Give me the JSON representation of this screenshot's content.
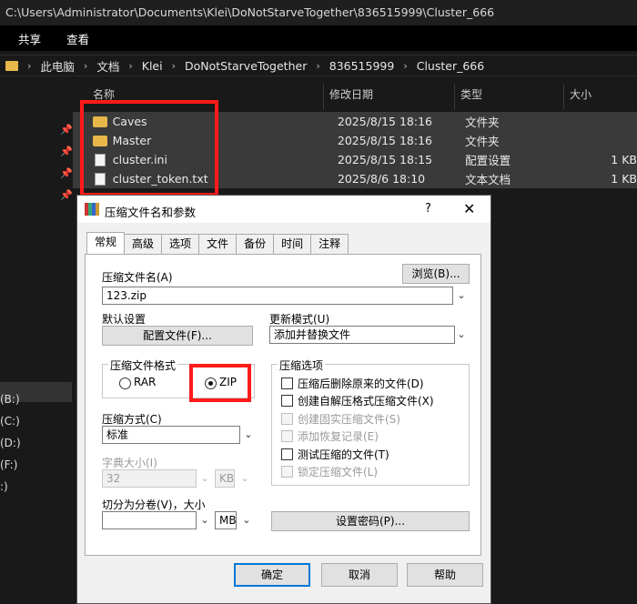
{
  "explorer": {
    "title_path": "C:\\Users\\Administrator\\Documents\\Klei\\DoNotStarveTogether\\836515999\\Cluster_666",
    "ribbon_tabs": [
      "共享",
      "查看"
    ],
    "breadcrumb": [
      "此电脑",
      "文档",
      "Klei",
      "DoNotStarveTogether",
      "836515999",
      "Cluster_666"
    ],
    "columns": {
      "name": "名称",
      "date": "修改日期",
      "type": "类型",
      "size": "大小"
    },
    "files": [
      {
        "name": "Caves",
        "date": "2025/8/15 18:16",
        "type": "文件夹",
        "size": "",
        "icon": "folder-icon"
      },
      {
        "name": "Master",
        "date": "2025/8/15 18:16",
        "type": "文件夹",
        "size": "",
        "icon": "folder-icon"
      },
      {
        "name": "cluster.ini",
        "date": "2025/8/15 18:15",
        "type": "配置设置",
        "size": "1 KB",
        "icon": "settings-file-icon"
      },
      {
        "name": "cluster_token.txt",
        "date": "2025/8/6 18:10",
        "type": "文本文档",
        "size": "1 KB",
        "icon": "text-file-icon"
      }
    ],
    "drives": [
      "(B:)",
      "(C:)",
      "(D:)",
      "(F:)",
      ":)"
    ]
  },
  "dialog": {
    "title": "压缩文件名和参数",
    "help_label": "?",
    "close_label": "✕",
    "tabs": [
      "常规",
      "高级",
      "选项",
      "文件",
      "备份",
      "时间",
      "注释"
    ],
    "archive_name_label": "压缩文件名(A)",
    "browse_label": "浏览(B)...",
    "archive_name_value": "123.zip",
    "default_settings_label": "默认设置",
    "profiles_label": "配置文件(F)...",
    "update_mode_label": "更新模式(U)",
    "update_mode_value": "添加并替换文件",
    "format_group_label": "压缩文件格式",
    "format_rar": "RAR",
    "format_zip": "ZIP",
    "format_selected": "ZIP",
    "method_label": "压缩方式(C)",
    "method_value": "标准",
    "dict_label": "字典大小(I)",
    "dict_value": "32",
    "dict_unit": "KB",
    "split_label": "切分为分卷(V)，大小",
    "split_value": "",
    "split_unit": "MB",
    "options_group_label": "压缩选项",
    "options": [
      {
        "label": "压缩后删除原来的文件(D)",
        "enabled": true,
        "checked": false
      },
      {
        "label": "创建自解压格式压缩文件(X)",
        "enabled": true,
        "checked": false
      },
      {
        "label": "创建固实压缩文件(S)",
        "enabled": false,
        "checked": false
      },
      {
        "label": "添加恢复记录(E)",
        "enabled": false,
        "checked": false
      },
      {
        "label": "测试压缩的文件(T)",
        "enabled": true,
        "checked": false
      },
      {
        "label": "锁定压缩文件(L)",
        "enabled": false,
        "checked": false
      }
    ],
    "set_password_label": "设置密码(P)...",
    "ok_label": "确定",
    "cancel_label": "取消",
    "help_button_label": "帮助"
  },
  "colors": {
    "highlight_red": "#ff1a1a",
    "folder_yellow": "#e8b74a",
    "focus_blue": "#0078d7"
  }
}
